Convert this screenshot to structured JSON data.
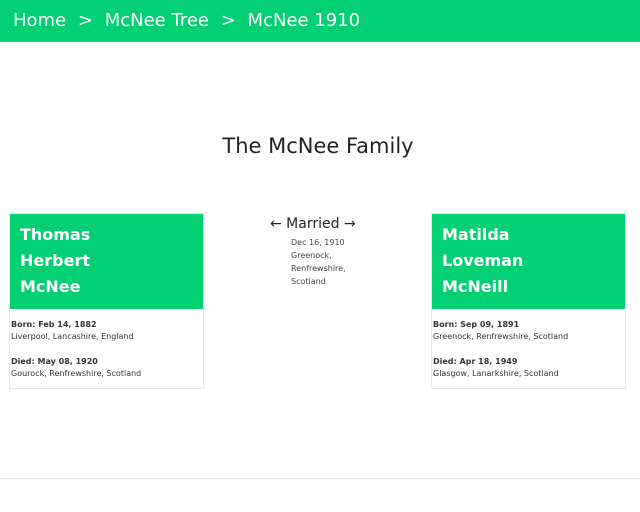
{
  "nav": {
    "breadcrumbs": [
      {
        "label": "Home"
      },
      {
        "label": "McNee Tree"
      },
      {
        "label": "McNee 1910"
      }
    ],
    "separator": ">"
  },
  "family": {
    "title": "The McNee Family"
  },
  "husband": {
    "name_lines": [
      "Thomas",
      "Herbert",
      "McNee"
    ],
    "born_label": "Born: Feb 14, 1882",
    "born_place": "Liverpool, Lancashire, England",
    "died_label": "Died: May 08, 1920",
    "died_place": "Gourock, Renfrewshire, Scotland"
  },
  "marriage": {
    "heading": "← Married →",
    "date": "Dec 16, 1910",
    "place_lines": [
      "Greenock,",
      "Renfrewshire,",
      "Scotland"
    ]
  },
  "wife": {
    "name_lines": [
      "Matilda",
      "Loveman",
      "McNeill"
    ],
    "born_label": "Born: Sep 09, 1891",
    "born_place": "Greenock, Renfrewshire, Scotland",
    "died_label": "Died: Apr 18, 1949",
    "died_place": "Glasgow, Lanarkshire, Scotland"
  },
  "colors": {
    "accent": "#03cf73",
    "header_text": "#ffffff"
  }
}
